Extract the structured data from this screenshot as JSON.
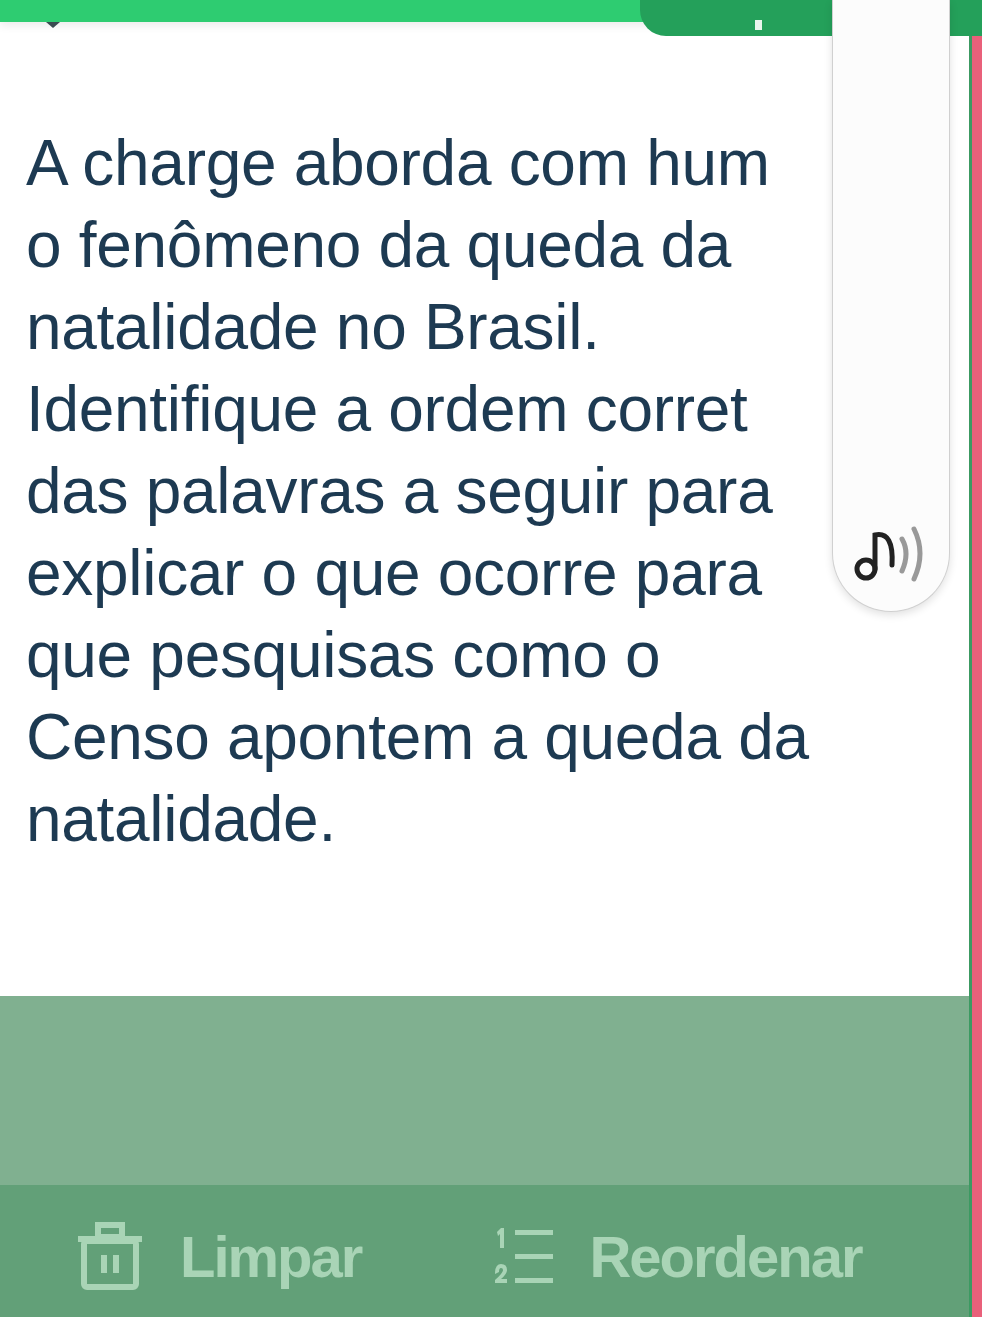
{
  "question": "A charge aborda com hum\no fenômeno da queda da\nnatalidade no Brasil.\nIdentifique a ordem corret\ndas palavras a seguir para\nexplicar o que ocorre para\nque pesquisas como o\nCenso apontem a queda da\nnatalidade.",
  "actions": [
    {
      "kind": "clear",
      "label": "Limpar"
    },
    {
      "kind": "reorder",
      "label": "Reordenar"
    }
  ]
}
